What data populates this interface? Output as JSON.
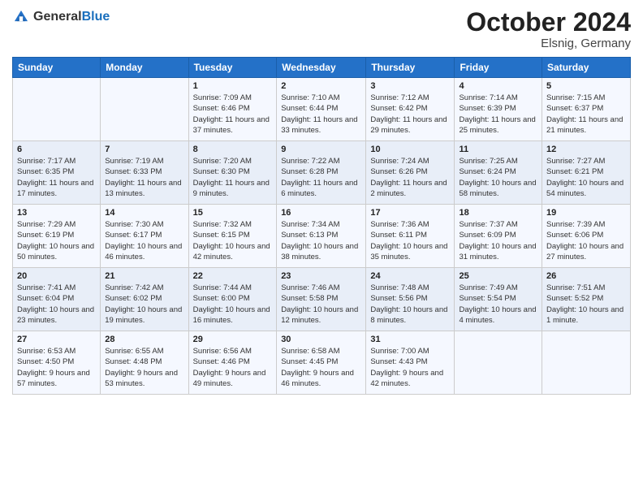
{
  "header": {
    "logo": {
      "general": "General",
      "blue": "Blue"
    },
    "month": "October 2024",
    "location": "Elsnig, Germany"
  },
  "weekdays": [
    "Sunday",
    "Monday",
    "Tuesday",
    "Wednesday",
    "Thursday",
    "Friday",
    "Saturday"
  ],
  "weeks": [
    [
      {
        "day": "",
        "sunrise": "",
        "sunset": "",
        "daylight": ""
      },
      {
        "day": "",
        "sunrise": "",
        "sunset": "",
        "daylight": ""
      },
      {
        "day": "1",
        "sunrise": "Sunrise: 7:09 AM",
        "sunset": "Sunset: 6:46 PM",
        "daylight": "Daylight: 11 hours and 37 minutes."
      },
      {
        "day": "2",
        "sunrise": "Sunrise: 7:10 AM",
        "sunset": "Sunset: 6:44 PM",
        "daylight": "Daylight: 11 hours and 33 minutes."
      },
      {
        "day": "3",
        "sunrise": "Sunrise: 7:12 AM",
        "sunset": "Sunset: 6:42 PM",
        "daylight": "Daylight: 11 hours and 29 minutes."
      },
      {
        "day": "4",
        "sunrise": "Sunrise: 7:14 AM",
        "sunset": "Sunset: 6:39 PM",
        "daylight": "Daylight: 11 hours and 25 minutes."
      },
      {
        "day": "5",
        "sunrise": "Sunrise: 7:15 AM",
        "sunset": "Sunset: 6:37 PM",
        "daylight": "Daylight: 11 hours and 21 minutes."
      }
    ],
    [
      {
        "day": "6",
        "sunrise": "Sunrise: 7:17 AM",
        "sunset": "Sunset: 6:35 PM",
        "daylight": "Daylight: 11 hours and 17 minutes."
      },
      {
        "day": "7",
        "sunrise": "Sunrise: 7:19 AM",
        "sunset": "Sunset: 6:33 PM",
        "daylight": "Daylight: 11 hours and 13 minutes."
      },
      {
        "day": "8",
        "sunrise": "Sunrise: 7:20 AM",
        "sunset": "Sunset: 6:30 PM",
        "daylight": "Daylight: 11 hours and 9 minutes."
      },
      {
        "day": "9",
        "sunrise": "Sunrise: 7:22 AM",
        "sunset": "Sunset: 6:28 PM",
        "daylight": "Daylight: 11 hours and 6 minutes."
      },
      {
        "day": "10",
        "sunrise": "Sunrise: 7:24 AM",
        "sunset": "Sunset: 6:26 PM",
        "daylight": "Daylight: 11 hours and 2 minutes."
      },
      {
        "day": "11",
        "sunrise": "Sunrise: 7:25 AM",
        "sunset": "Sunset: 6:24 PM",
        "daylight": "Daylight: 10 hours and 58 minutes."
      },
      {
        "day": "12",
        "sunrise": "Sunrise: 7:27 AM",
        "sunset": "Sunset: 6:21 PM",
        "daylight": "Daylight: 10 hours and 54 minutes."
      }
    ],
    [
      {
        "day": "13",
        "sunrise": "Sunrise: 7:29 AM",
        "sunset": "Sunset: 6:19 PM",
        "daylight": "Daylight: 10 hours and 50 minutes."
      },
      {
        "day": "14",
        "sunrise": "Sunrise: 7:30 AM",
        "sunset": "Sunset: 6:17 PM",
        "daylight": "Daylight: 10 hours and 46 minutes."
      },
      {
        "day": "15",
        "sunrise": "Sunrise: 7:32 AM",
        "sunset": "Sunset: 6:15 PM",
        "daylight": "Daylight: 10 hours and 42 minutes."
      },
      {
        "day": "16",
        "sunrise": "Sunrise: 7:34 AM",
        "sunset": "Sunset: 6:13 PM",
        "daylight": "Daylight: 10 hours and 38 minutes."
      },
      {
        "day": "17",
        "sunrise": "Sunrise: 7:36 AM",
        "sunset": "Sunset: 6:11 PM",
        "daylight": "Daylight: 10 hours and 35 minutes."
      },
      {
        "day": "18",
        "sunrise": "Sunrise: 7:37 AM",
        "sunset": "Sunset: 6:09 PM",
        "daylight": "Daylight: 10 hours and 31 minutes."
      },
      {
        "day": "19",
        "sunrise": "Sunrise: 7:39 AM",
        "sunset": "Sunset: 6:06 PM",
        "daylight": "Daylight: 10 hours and 27 minutes."
      }
    ],
    [
      {
        "day": "20",
        "sunrise": "Sunrise: 7:41 AM",
        "sunset": "Sunset: 6:04 PM",
        "daylight": "Daylight: 10 hours and 23 minutes."
      },
      {
        "day": "21",
        "sunrise": "Sunrise: 7:42 AM",
        "sunset": "Sunset: 6:02 PM",
        "daylight": "Daylight: 10 hours and 19 minutes."
      },
      {
        "day": "22",
        "sunrise": "Sunrise: 7:44 AM",
        "sunset": "Sunset: 6:00 PM",
        "daylight": "Daylight: 10 hours and 16 minutes."
      },
      {
        "day": "23",
        "sunrise": "Sunrise: 7:46 AM",
        "sunset": "Sunset: 5:58 PM",
        "daylight": "Daylight: 10 hours and 12 minutes."
      },
      {
        "day": "24",
        "sunrise": "Sunrise: 7:48 AM",
        "sunset": "Sunset: 5:56 PM",
        "daylight": "Daylight: 10 hours and 8 minutes."
      },
      {
        "day": "25",
        "sunrise": "Sunrise: 7:49 AM",
        "sunset": "Sunset: 5:54 PM",
        "daylight": "Daylight: 10 hours and 4 minutes."
      },
      {
        "day": "26",
        "sunrise": "Sunrise: 7:51 AM",
        "sunset": "Sunset: 5:52 PM",
        "daylight": "Daylight: 10 hours and 1 minute."
      }
    ],
    [
      {
        "day": "27",
        "sunrise": "Sunrise: 6:53 AM",
        "sunset": "Sunset: 4:50 PM",
        "daylight": "Daylight: 9 hours and 57 minutes."
      },
      {
        "day": "28",
        "sunrise": "Sunrise: 6:55 AM",
        "sunset": "Sunset: 4:48 PM",
        "daylight": "Daylight: 9 hours and 53 minutes."
      },
      {
        "day": "29",
        "sunrise": "Sunrise: 6:56 AM",
        "sunset": "Sunset: 4:46 PM",
        "daylight": "Daylight: 9 hours and 49 minutes."
      },
      {
        "day": "30",
        "sunrise": "Sunrise: 6:58 AM",
        "sunset": "Sunset: 4:45 PM",
        "daylight": "Daylight: 9 hours and 46 minutes."
      },
      {
        "day": "31",
        "sunrise": "Sunrise: 7:00 AM",
        "sunset": "Sunset: 4:43 PM",
        "daylight": "Daylight: 9 hours and 42 minutes."
      },
      {
        "day": "",
        "sunrise": "",
        "sunset": "",
        "daylight": ""
      },
      {
        "day": "",
        "sunrise": "",
        "sunset": "",
        "daylight": ""
      }
    ]
  ]
}
